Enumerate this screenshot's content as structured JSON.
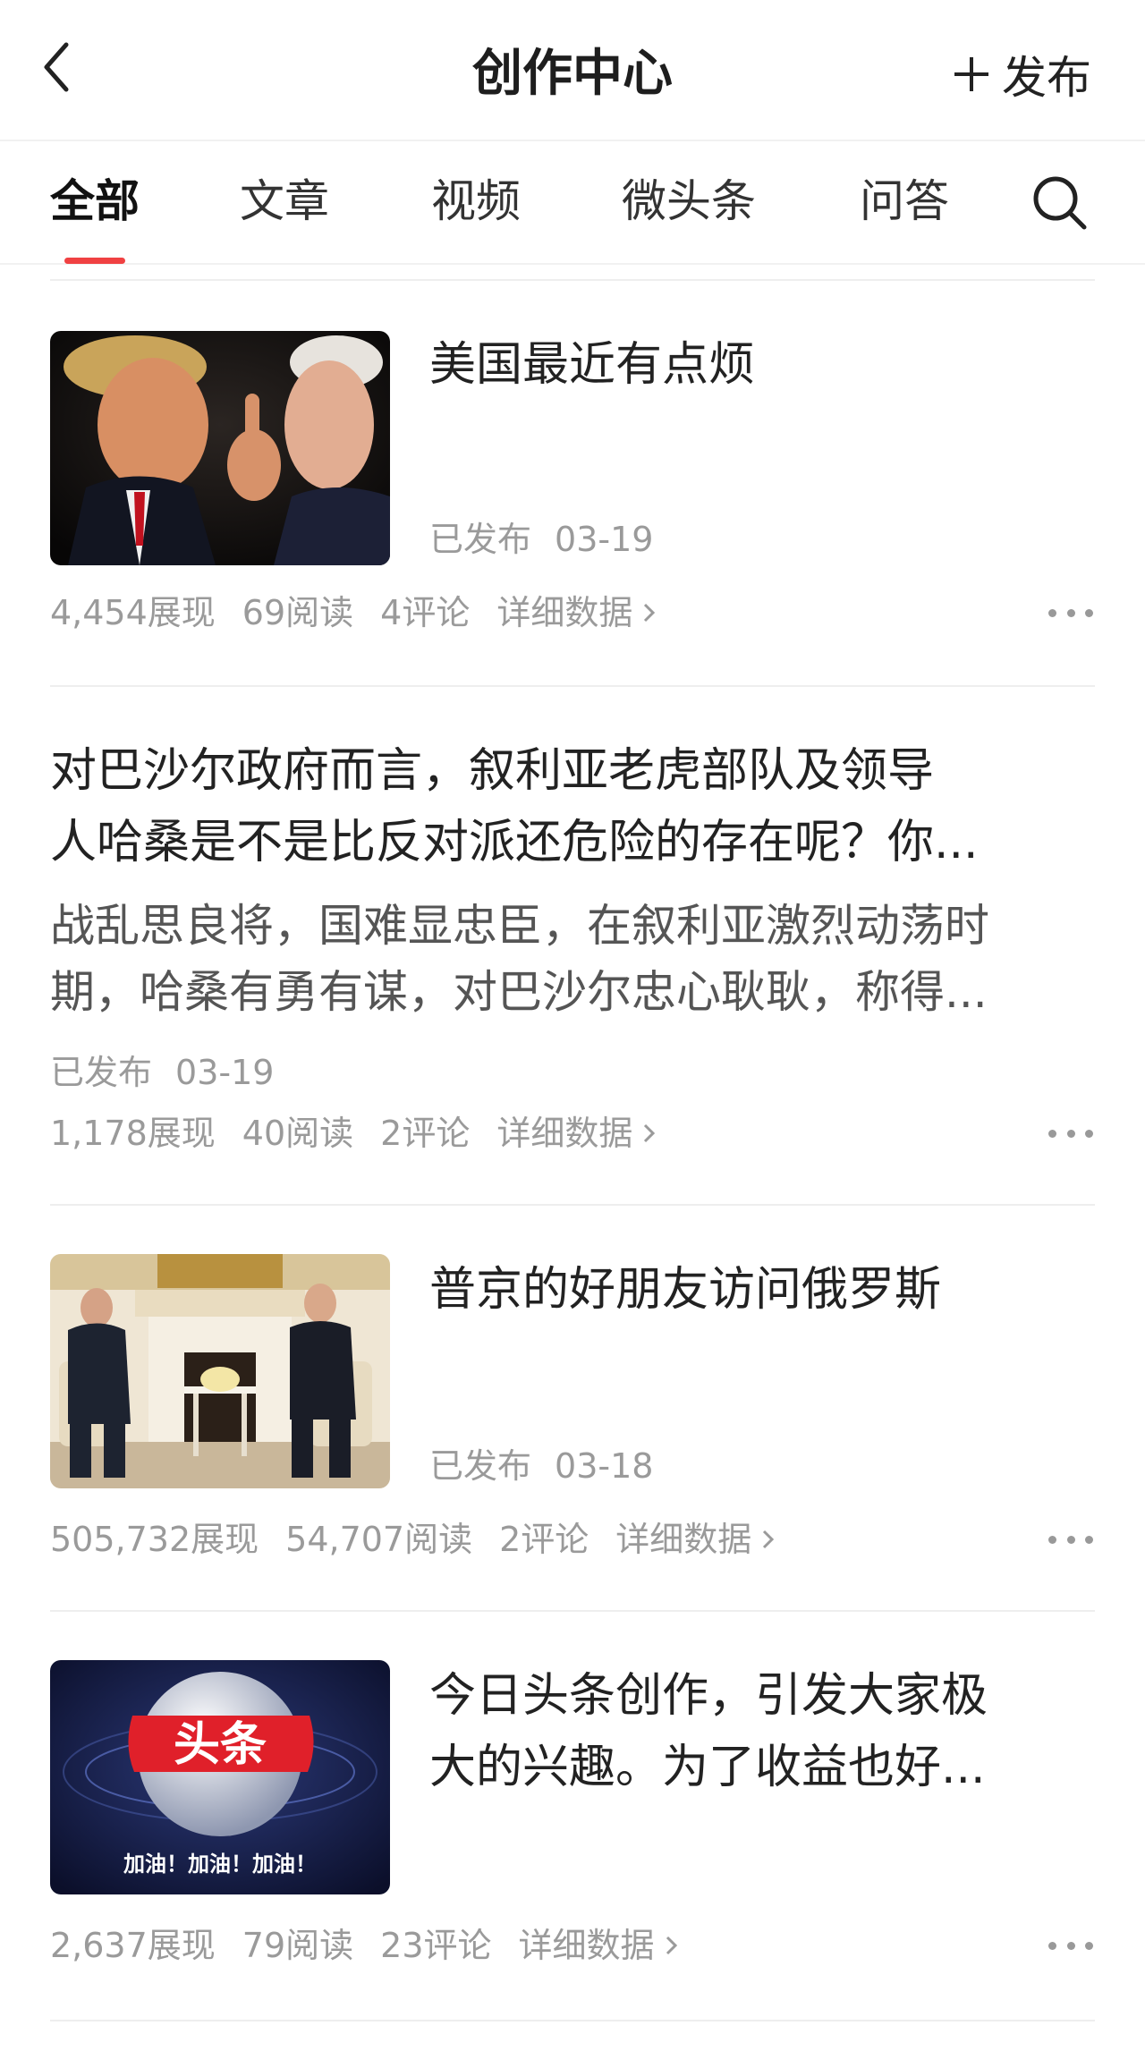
{
  "header": {
    "title": "创作中心",
    "publish_label": "发布"
  },
  "tabs": [
    "全部",
    "文章",
    "视频",
    "微头条",
    "问答"
  ],
  "colors": {
    "accent": "#f04142",
    "meta": "#9a9a9a"
  },
  "items": [
    {
      "title": "美国最近有点烦",
      "status": "已发布",
      "date": "03-19",
      "views": "4,454展现",
      "reads": "69阅读",
      "comments": "4评论",
      "detail": "详细数据"
    },
    {
      "title_line1": "对巴沙尔政府而言，叙利亚老虎部队及领导",
      "title_line2": "人哈桑是不是比反对派还危险的存在呢？你...",
      "summary_line1": "战乱思良将，国难显忠臣，在叙利亚激烈动荡时",
      "summary_line2": "期，哈桑有勇有谋，对巴沙尔忠心耿耿，称得...",
      "status": "已发布",
      "date": "03-19",
      "views": "1,178展现",
      "reads": "40阅读",
      "comments": "2评论",
      "detail": "详细数据"
    },
    {
      "title": "普京的好朋友访问俄罗斯",
      "status": "已发布",
      "date": "03-18",
      "views": "505,732展现",
      "reads": "54,707阅读",
      "comments": "2评论",
      "detail": "详细数据"
    },
    {
      "title_line1": "今日头条创作，引发大家极",
      "title_line2": "大的兴趣。为了收益也好...",
      "thumb_logo": "头条",
      "thumb_caption": "加油！加油！加油！",
      "views": "2,637展现",
      "reads": "79阅读",
      "comments": "23评论",
      "detail": "详细数据"
    }
  ]
}
